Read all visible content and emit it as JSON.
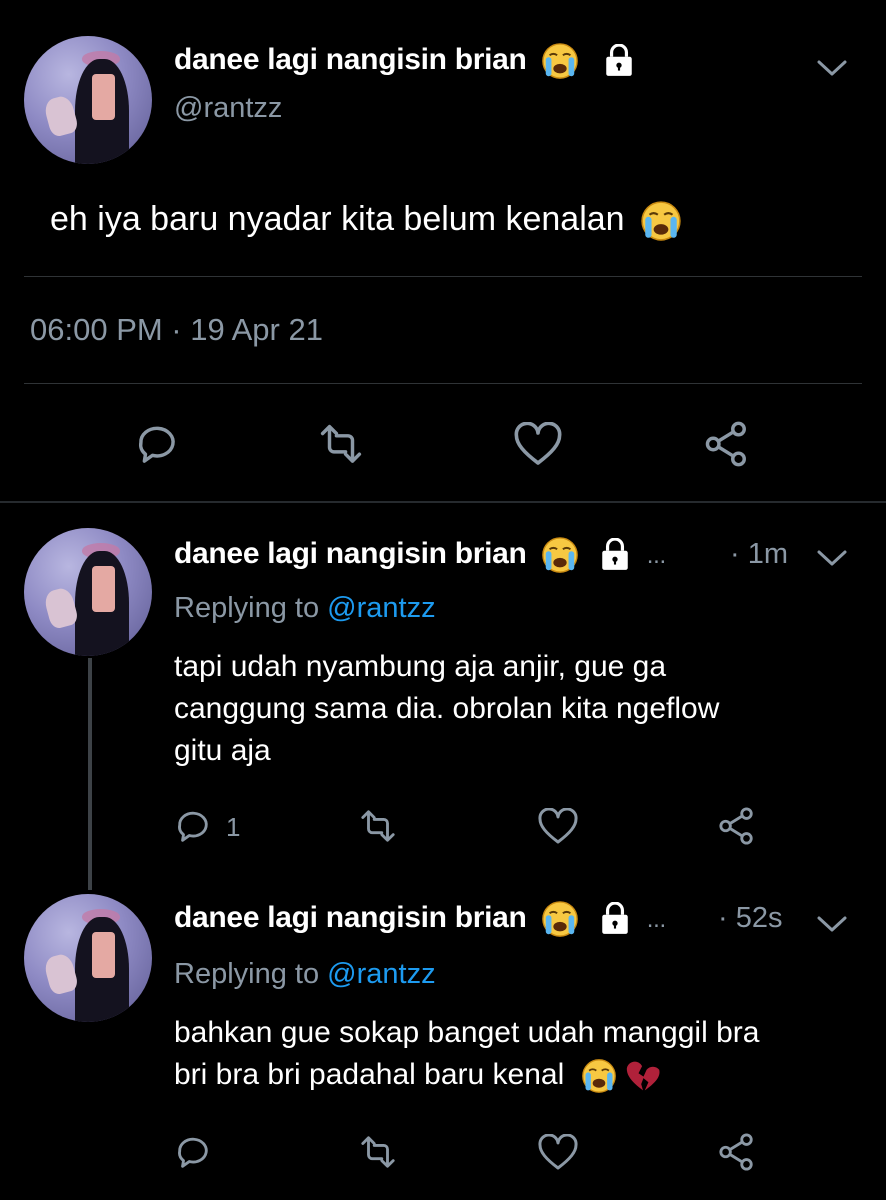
{
  "main_tweet": {
    "display_name": "danee lagi nangisin brian",
    "handle": "@rantzz",
    "text": "eh iya baru nyadar kita belum kenalan",
    "time": "06:00 PM · 19 Apr 21",
    "icons": [
      "crying-emoji",
      "lock-icon",
      "chevron-down-icon",
      "reply-icon",
      "retweet-icon",
      "like-icon",
      "share-icon"
    ]
  },
  "replies": [
    {
      "display_name": "danee lagi nangisin brian",
      "ellipsis": "...",
      "age": "· 1m",
      "replying_label": "Replying to",
      "replying_handle": "@rantzz",
      "text_lines": [
        "tapi udah nyambung aja anjir, gue ga",
        "canggung sama dia. obrolan kita ngeflow",
        "gitu aja"
      ],
      "reply_count": "1"
    },
    {
      "display_name": "danee lagi nangisin brian",
      "ellipsis": "...",
      "age": "· 52s",
      "replying_label": "Replying to",
      "replying_handle": "@rantzz",
      "text_lines": [
        "bahkan gue sokap banget udah manggil bra",
        "bri bra bri padahal baru kenal"
      ],
      "reply_count": ""
    }
  ],
  "colors": {
    "background": "#000000",
    "muted": "#8b98a5",
    "link": "#1d9bf0",
    "divider": "#2f3336"
  }
}
